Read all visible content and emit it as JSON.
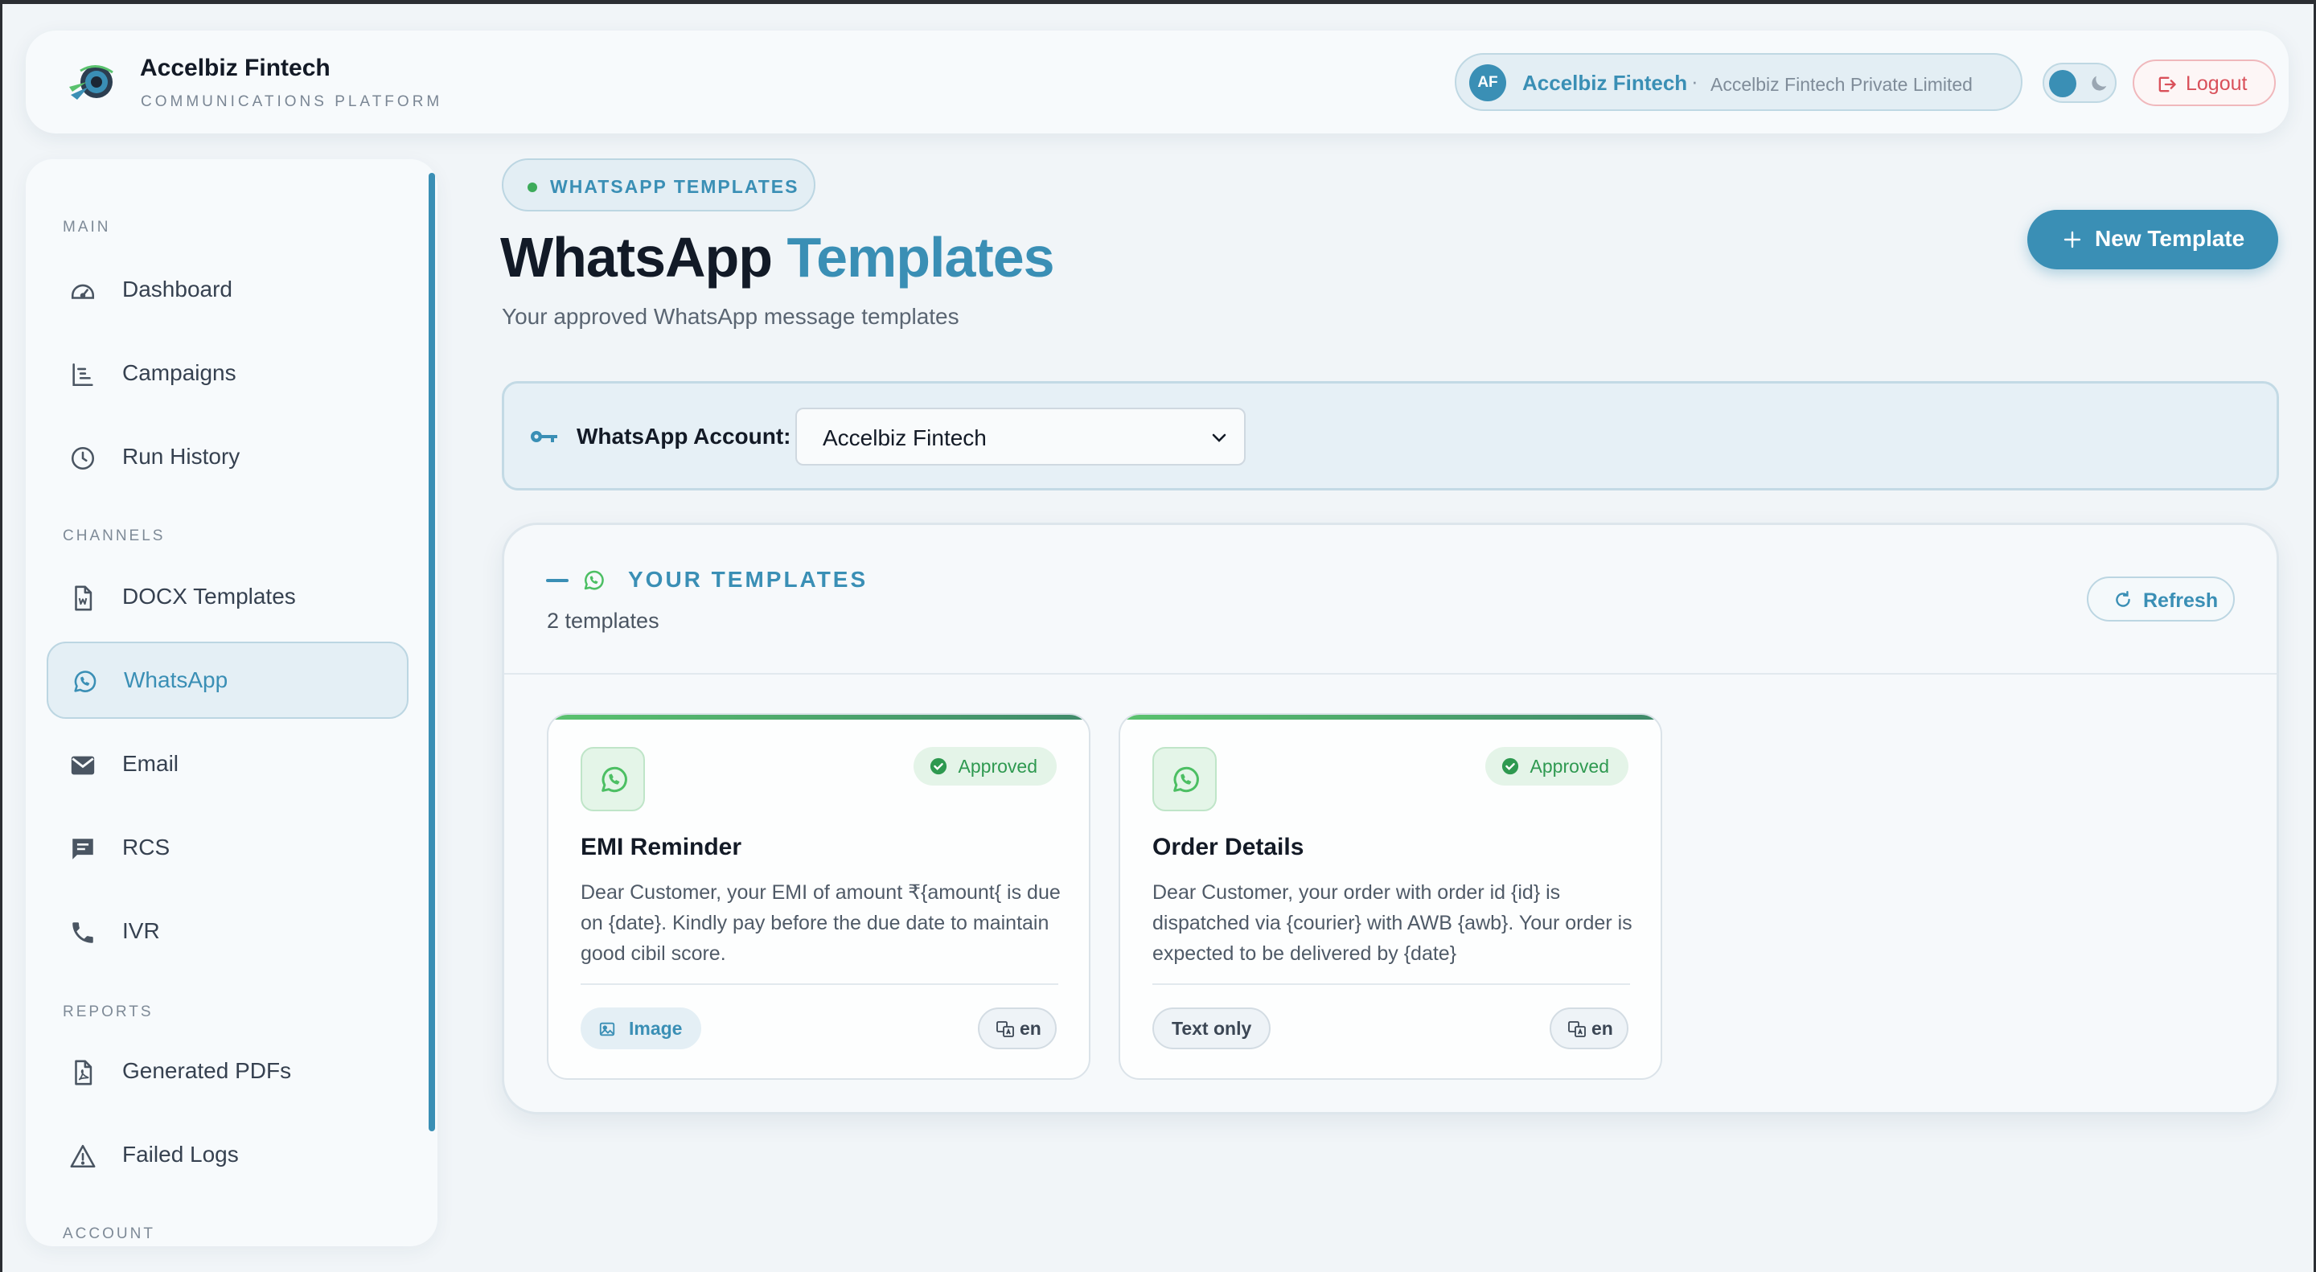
{
  "header": {
    "brand_name": "Accelbiz Fintech",
    "brand_subtitle": "COMMUNICATIONS PLATFORM",
    "user_initials": "AF",
    "user_name": "Accelbiz Fintech",
    "separator": "·",
    "user_org": "Accelbiz Fintech Private Limited",
    "logout_label": "Logout"
  },
  "sidebar": {
    "sections": {
      "main": "MAIN",
      "channels": "CHANNELS",
      "reports": "REPORTS",
      "account": "ACCOUNT"
    },
    "items": [
      {
        "label": "Dashboard",
        "icon": "gauge-icon"
      },
      {
        "label": "Campaigns",
        "icon": "campaigns-icon"
      },
      {
        "label": "Run History",
        "icon": "clock-icon"
      },
      {
        "label": "DOCX Templates",
        "icon": "docx-file-icon"
      },
      {
        "label": "WhatsApp",
        "icon": "whatsapp-icon",
        "active": true
      },
      {
        "label": "Email",
        "icon": "envelope-icon"
      },
      {
        "label": "RCS",
        "icon": "chat-bubble-icon"
      },
      {
        "label": "IVR",
        "icon": "phone-icon"
      },
      {
        "label": "Generated PDFs",
        "icon": "pdf-file-icon"
      },
      {
        "label": "Failed Logs",
        "icon": "warning-icon"
      }
    ]
  },
  "main": {
    "breadcrumb": "WHATSAPP TEMPLATES",
    "title_part1": "WhatsApp",
    "title_part2": "Templates",
    "subtitle": "Your approved WhatsApp message templates",
    "new_button": "New Template",
    "account_label": "WhatsApp Account:",
    "account_selected": "Accelbiz Fintech",
    "panel": {
      "title": "YOUR TEMPLATES",
      "count": "2 templates",
      "refresh_label": "Refresh"
    },
    "templates": [
      {
        "name": "EMI Reminder",
        "status": "Approved",
        "body": "Dear Customer, your EMI of amount ₹{amount{ is due on {date}. Kindly pay before the due date to maintain good cibil score.",
        "type": "Image",
        "language": "en"
      },
      {
        "name": "Order Details",
        "status": "Approved",
        "body": "Dear Customer, your order with order id {id} is dispatched via {courier} with AWB {awb}. Your order is expected to be delivered by {date}",
        "type": "Text only",
        "language": "en"
      }
    ]
  },
  "colors": {
    "accent": "#3a8fb5",
    "approved": "#2e9950",
    "whatsapp": "#4cbf63",
    "logout": "#d9505a",
    "background": "#f1f5f8"
  }
}
